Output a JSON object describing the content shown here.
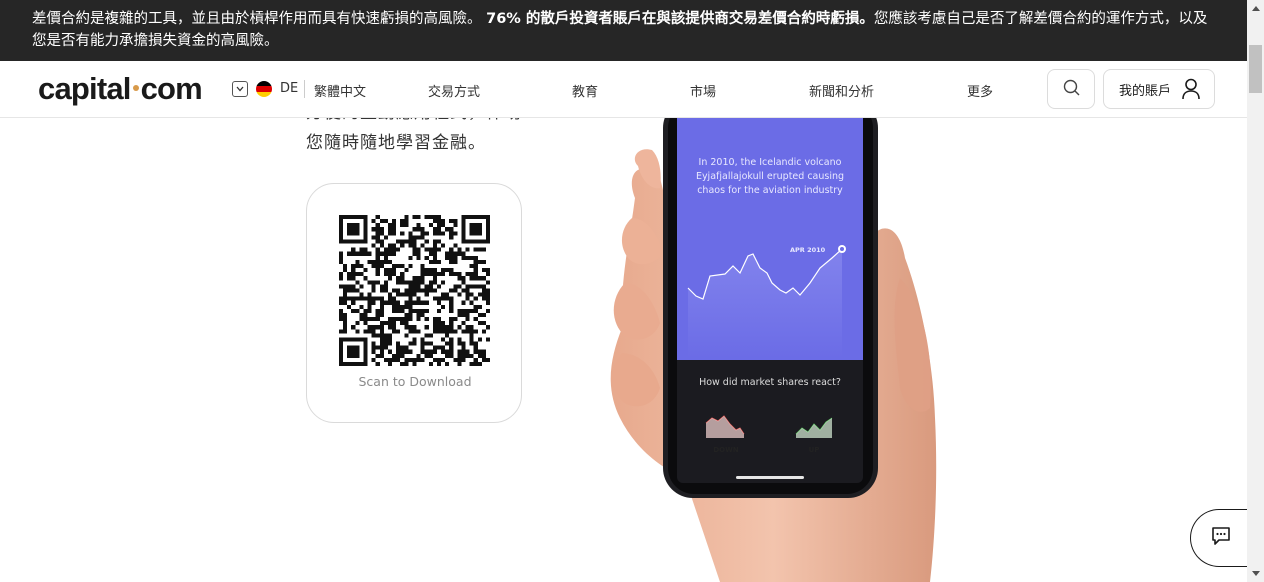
{
  "risk_banner": {
    "text_before": "差價合約是複雜的工具，並且由於槓桿作用而具有快速虧損的高風險。",
    "text_bold": "76% 的散戶投資者賬戶在與該提供商交易差價合約時虧損。",
    "text_after": "您應該考慮自己是否了解差價合約的運作方式，以及您是否有能力承擔損失資金的高風險。"
  },
  "header": {
    "logo_left": "capital",
    "logo_right": "com",
    "lang_code": "DE",
    "lang_name": "繁體中文",
    "nav": [
      "交易方式",
      "教育",
      "市場",
      "新聞和分析",
      "更多"
    ],
    "account_label": "我的賬戶"
  },
  "intro": {
    "line1": "方便的互動應用程式，伴助",
    "line2": "您隨時隨地學習金融。"
  },
  "qr": {
    "caption": "Scan to Download"
  },
  "phone": {
    "caption": "In 2010, the Icelandic volcano Eyjafjallajokull erupted causing chaos for the aviation industry",
    "date_label": "APR 2010",
    "question": "How did market shares react?",
    "option_down": "DOWN",
    "option_up": "UP"
  },
  "icons": {
    "search": "search-icon",
    "user": "user-icon",
    "chat": "chat-icon",
    "chevron": "chevron-down-icon",
    "flag": "flag-de-icon"
  },
  "colors": {
    "banner_bg": "#262626",
    "accent_dot": "#d89a4a",
    "phone_screen": "#6b6ce6"
  }
}
